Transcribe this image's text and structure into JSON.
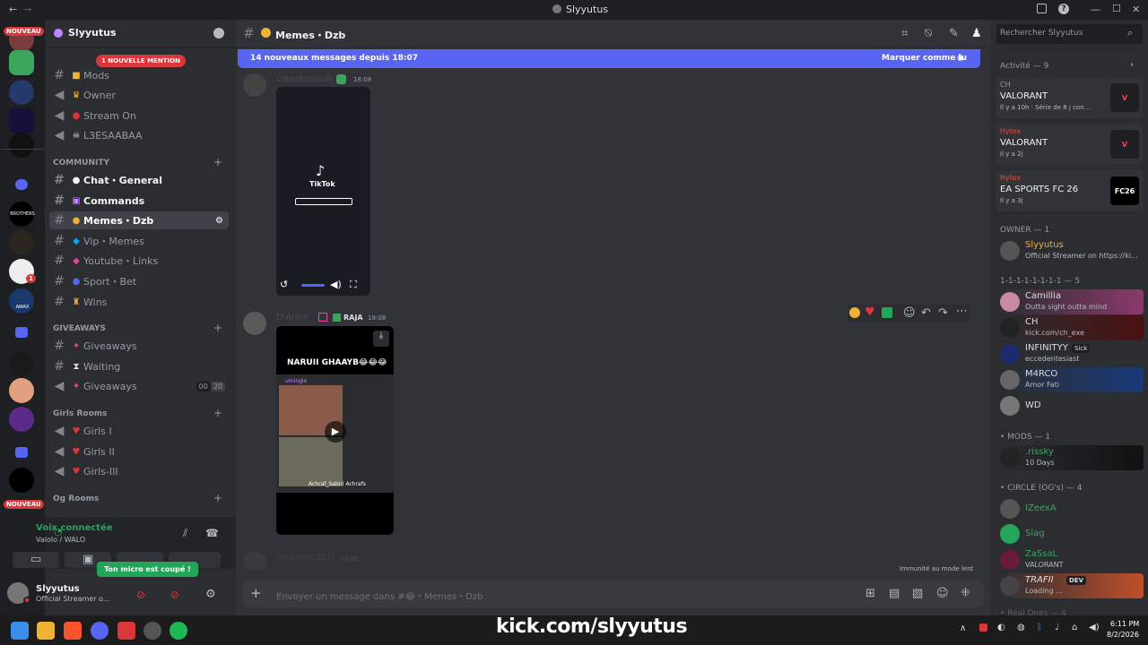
{
  "window": {
    "title": "Slyyutus",
    "nav_back": "←",
    "nav_forward": "→",
    "minimize": "—",
    "maximize": "☐",
    "close": "✕"
  },
  "servers": {
    "badge_top": "NOUVEAU",
    "badge_bottom": "NOUVEAU",
    "brothers_label": "BROTHERS",
    "awax_label": "AWAX",
    "notif_count": "1"
  },
  "server_header": {
    "name": "Slyyutus"
  },
  "mention_pill": "1 NOUVELLE MENTION",
  "channels": {
    "top": [
      {
        "name": "Mods"
      },
      {
        "name": "Owner"
      },
      {
        "name": "Stream On"
      },
      {
        "name": "L3ESAABAA"
      }
    ],
    "community_label": "COMMUNITY",
    "community": [
      {
        "name": "Chat・General"
      },
      {
        "name": "Commands"
      },
      {
        "name": "Memes・Dzb"
      },
      {
        "name": "Vip・Memes"
      },
      {
        "name": "Youtube・Links"
      },
      {
        "name": "Sport・Bet"
      },
      {
        "name": "Wins"
      }
    ],
    "giveaways_label": "GIVEAWAYS",
    "giveaways": [
      {
        "name": "Giveaways"
      },
      {
        "name": "Waiting"
      },
      {
        "name": "Giveaways",
        "c1": "00",
        "c2": "20"
      }
    ],
    "girls_label": "Girls Rooms",
    "girls": [
      {
        "name": "Girls I"
      },
      {
        "name": "Girls II"
      },
      {
        "name": "Girls-III"
      }
    ],
    "og_label": "Og Rooms"
  },
  "voice": {
    "status": "Voix connectée",
    "channel": "Valolo / WALO",
    "tooltip": "Ton micro est coupé !"
  },
  "user": {
    "name": "Slyyutus",
    "status": "Official Streamer o..."
  },
  "chat_header": {
    "channel": "Memes・Dzb"
  },
  "new_messages": {
    "text": "14 nouveaux messages depuis 18:07",
    "action": "Marquer comme lu"
  },
  "messages": [
    {
      "author": "cleanbruuuh",
      "time": "18:08",
      "embed_label": "TikTok"
    },
    {
      "author": "D'AnnY",
      "tag": "RAJA",
      "time": "18:08",
      "video_caption": "NARUII GHAAYB😂😂😂",
      "video_tag": "umingle",
      "video_footer": "Achraf_Sabiri  Achrafs"
    },
    {
      "author": "WIDHAMCEED",
      "time": "18:08"
    }
  ],
  "slowmode": "Immunité au mode lent",
  "composer": {
    "placeholder": "Envoyer un message dans #😂・Memes・Dzb"
  },
  "search": {
    "placeholder": "Rechercher Slyyutus"
  },
  "activity": {
    "header": "Activité — 9",
    "items": [
      {
        "who": "CH",
        "game": "VALORANT",
        "when": "Il y a 10h · Série de 8 j con...",
        "logo": "V"
      },
      {
        "who": "Hytex",
        "game": "VALORANT",
        "when": "Il y a 2j",
        "logo": "V"
      },
      {
        "who": "Hytex",
        "game": "EA SPORTS FC 26",
        "when": "Il y a 3j",
        "logo": "FC26"
      }
    ]
  },
  "member_sections": {
    "owner": "OWNER — 1",
    "circle1": "1-1-1-1-1-1-1-1 — 5",
    "mods": "• MODS — 1",
    "circle": "• CIRCLE (OG's) — 4",
    "real": "• Real Ones — 4"
  },
  "members": [
    {
      "name": "Slyyutus",
      "status": "Official Streamer on https://ki...",
      "color": "#f0b232"
    },
    {
      "name": "Camillia",
      "status": "Outta sight outta mind",
      "color": "#dbdee1"
    },
    {
      "name": "CH",
      "status": "kick.com/ch_exe",
      "color": "#dbdee1"
    },
    {
      "name": "INFINITYY",
      "status": "eccedentesiast",
      "color": "#dbdee1",
      "tag": "Sick"
    },
    {
      "name": "M4RCO",
      "status": "Amor Fati",
      "color": "#dbdee1"
    },
    {
      "name": "WD",
      "status": "",
      "color": "#dbdee1"
    },
    {
      "name": ".rissky",
      "status": "10 Days",
      "color": "#3ba55d"
    },
    {
      "name": "IZeexA",
      "status": "",
      "color": "#3ba55d"
    },
    {
      "name": "Slag",
      "status": "",
      "color": "#3ba55d"
    },
    {
      "name": "ZaSsaL",
      "status": "VALORANT",
      "color": "#3ba55d"
    },
    {
      "name": "TRAFII",
      "status": "Loading ...",
      "color": "#dbdee1",
      "tag": "DEV"
    }
  ],
  "overlay": {
    "kick": "kick.com/slyyutus"
  },
  "clock": {
    "time": "6:11 PM",
    "date": "8/2/2026"
  },
  "colors": {
    "accent": "#5865f2",
    "danger": "#da373c",
    "online": "#23a55a",
    "kick": "#53fc18"
  }
}
